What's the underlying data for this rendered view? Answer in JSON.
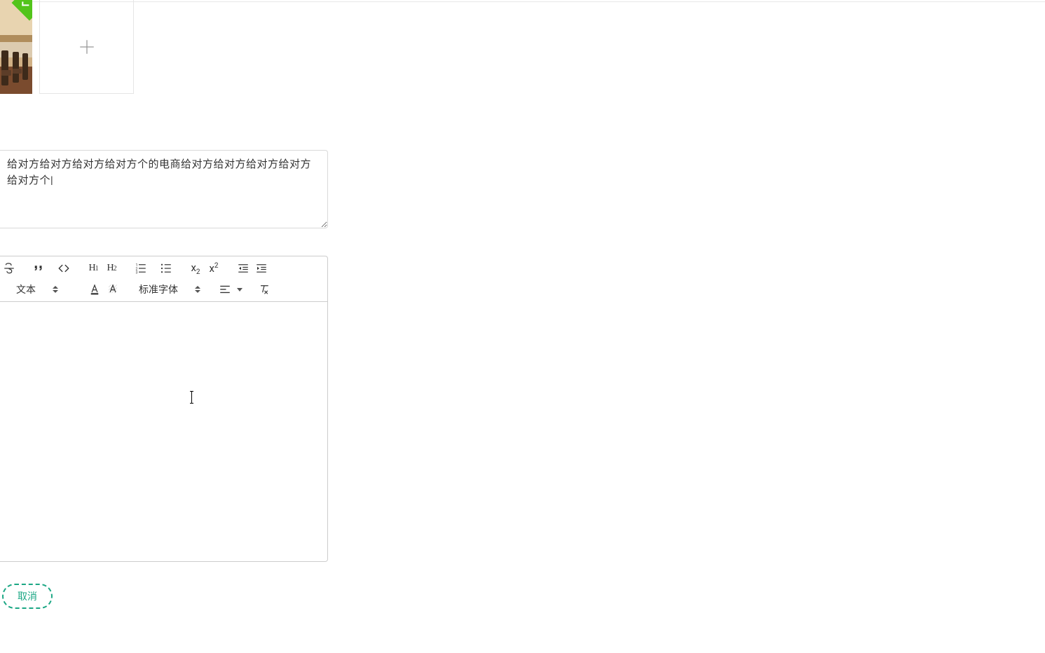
{
  "thumbnails": {
    "selected": true,
    "add_aria": "添加图片"
  },
  "description": {
    "value": "给对方给对方给对方给对方个的电商给对方给对方给对方给对方给对方个|"
  },
  "editor": {
    "text_style_selected": "文本",
    "font_selected": "标准字体",
    "toolbar_icons": {
      "strike": "strikethrough-icon",
      "quote": "quote-icon",
      "code": "code-icon",
      "h1": "H1",
      "h2": "H2",
      "ol": "ordered-list-icon",
      "ul": "unordered-list-icon",
      "sub": "x2",
      "sup": "x2",
      "indent_dec": "indent-decrease-icon",
      "indent_inc": "indent-increase-icon",
      "fontcolor": "font-color-icon",
      "bgcolor": "background-color-icon",
      "align": "align-icon",
      "clear": "clear-format-icon"
    }
  },
  "buttons": {
    "cancel": "取消"
  }
}
